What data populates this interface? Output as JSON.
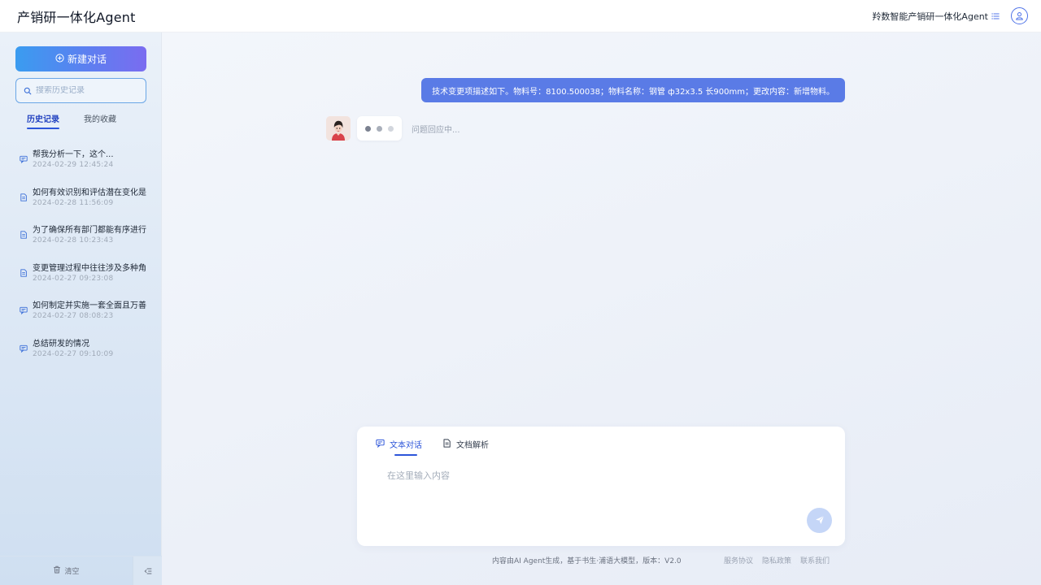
{
  "header": {
    "title": "产销研一体化Agent",
    "org_link": "羚数智能产销研一体化Agent"
  },
  "sidebar": {
    "new_chat_label": "新建对话",
    "search_placeholder": "搜索历史记录",
    "tabs": [
      {
        "label": "历史记录",
        "active": true
      },
      {
        "label": "我的收藏",
        "active": false
      }
    ],
    "history": [
      {
        "title": "帮我分析一下，这个...",
        "date": "2024-02-29  12:45:24",
        "icon": "chat-icon"
      },
      {
        "title": "如何有效识别和评估潜在变化是",
        "date": "2024-02-28  11:56:09",
        "icon": "document-icon"
      },
      {
        "title": "为了确保所有部门都能有序进行",
        "date": "2024-02-28  10:23:43",
        "icon": "document-icon"
      },
      {
        "title": "变更管理过程中往往涉及多种角",
        "date": "2024-02-27  09:23:08",
        "icon": "document-icon"
      },
      {
        "title": "如何制定并实施一套全面且万善",
        "date": "2024-02-27  08:08:23",
        "icon": "chat-icon"
      },
      {
        "title": "总结研发的情况",
        "date": "2024-02-27  09:10:09",
        "icon": "chat-icon"
      }
    ],
    "clear_label": "清空"
  },
  "chat": {
    "user_message": "技术变更项描述如下。物料号：8100.500038；物料名称：钢管 ф32x3.5 长900mm；更改内容：新增物料。",
    "status_text": "问题回应中...",
    "typing_dot_colors": [
      "#7b8190",
      "#a9afba",
      "#d2d6dd"
    ]
  },
  "input": {
    "modes": [
      {
        "label": "文本对话",
        "icon": "chat-icon",
        "active": true
      },
      {
        "label": "文档解析",
        "icon": "document-icon",
        "active": false
      }
    ],
    "placeholder": "在这里输入内容"
  },
  "footer": {
    "disclaimer": "内容由AI Agent生成，基于书生·浦语大模型，版本：V2.0",
    "links": [
      "服务协议",
      "隐私政策",
      "联系我们"
    ]
  },
  "colors": {
    "accent": "#2c55d9",
    "user_bubble": "#5a7be6",
    "new_chat_gradient_start": "#3a9cf0",
    "new_chat_gradient_end": "#7a6cf0"
  }
}
